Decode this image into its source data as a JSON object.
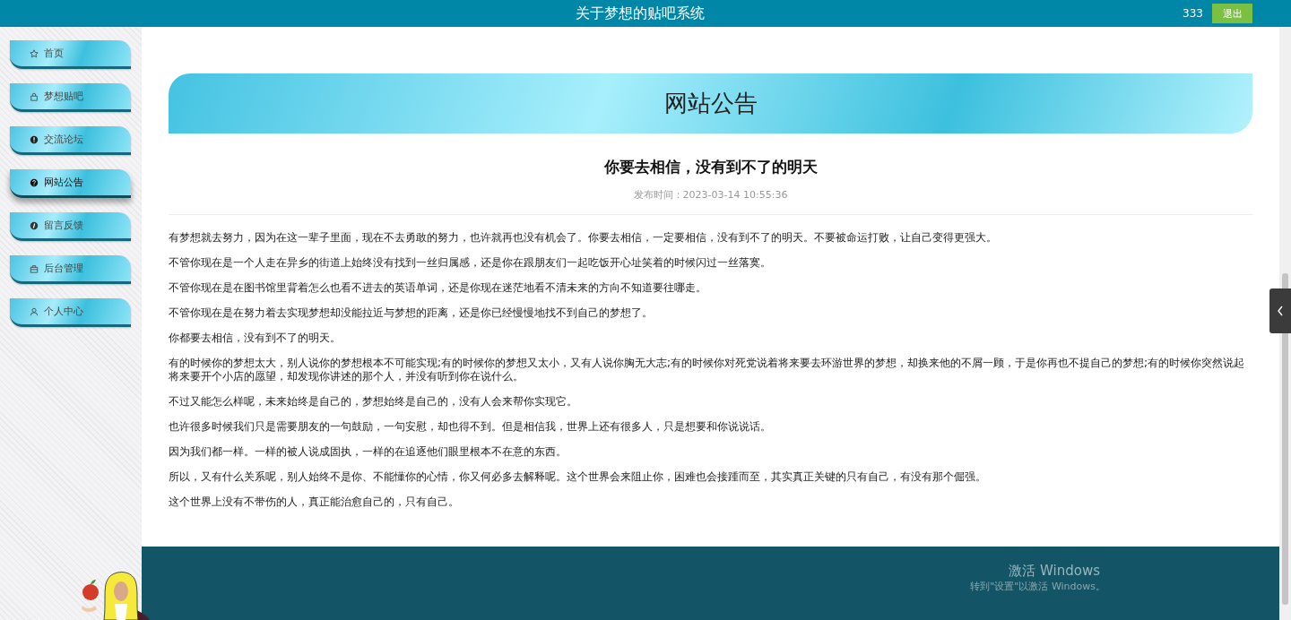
{
  "header": {
    "title": "关于梦想的贴吧系统",
    "username": "333",
    "logout": "退出"
  },
  "sidebar": {
    "items": [
      {
        "label": "首页",
        "selected": false
      },
      {
        "label": "梦想贴吧",
        "selected": false
      },
      {
        "label": "交流论坛",
        "selected": false
      },
      {
        "label": "网站公告",
        "selected": true
      },
      {
        "label": "留言反馈",
        "selected": false
      },
      {
        "label": "后台管理",
        "selected": false
      },
      {
        "label": "个人中心",
        "selected": false
      }
    ]
  },
  "banner": {
    "title": "网站公告"
  },
  "article": {
    "title": "你要去相信，没有到不了的明天",
    "published": "发布时间：2023-03-14 10:55:36",
    "paragraphs": [
      "有梦想就去努力，因为在这一辈子里面，现在不去勇敢的努力，也许就再也没有机会了。你要去相信，一定要相信，没有到不了的明天。不要被命运打败，让自己变得更强大。",
      "不管你现在是一个人走在异乡的街道上始终没有找到一丝归属感，还是你在跟朋友们一起吃饭开心址笑着的时候闪过一丝落寞。",
      "不管你现在是在图书馆里背着怎么也看不进去的英语单词，还是你现在迷茫地看不清未来的方向不知道要往哪走。",
      "不管你现在是在努力着去实现梦想却没能拉近与梦想的距离，还是你已经慢慢地找不到自己的梦想了。",
      "你都要去相信，没有到不了的明天。",
      "有的时候你的梦想太大，别人说你的梦想根本不可能实现;有的时候你的梦想又太小，又有人说你胸无大志;有的时候你对死党说着将来要去环游世界的梦想，却换来他的不屑一顾，于是你再也不提自己的梦想;有的时候你突然说起将来要开个小店的愿望，却发现你讲述的那个人，并没有听到你在说什么。",
      "不过又能怎么样呢，未来始终是自己的，梦想始终是自己的，没有人会来帮你实现它。",
      "也许很多时候我们只是需要朋友的一句鼓励，一句安慰，却也得不到。但是相信我，世界上还有很多人，只是想要和你说说话。",
      "因为我们都一样。一样的被人说成固执，一样的在追逐他们眼里根本不在意的东西。",
      "所以，又有什么关系呢，别人始终不是你、不能懂你的心情，你又何必多去解释呢。这个世界会来阻止你，困难也会接踵而至，其实真正关键的只有自己，有没有那个倔强。",
      "这个世界上没有不带伤的人，真正能治愈自己的，只有自己。"
    ]
  },
  "footer": {
    "activation_title": "激活 Windows",
    "activation_hint": "转到\"设置\"以激活 Windows。"
  }
}
